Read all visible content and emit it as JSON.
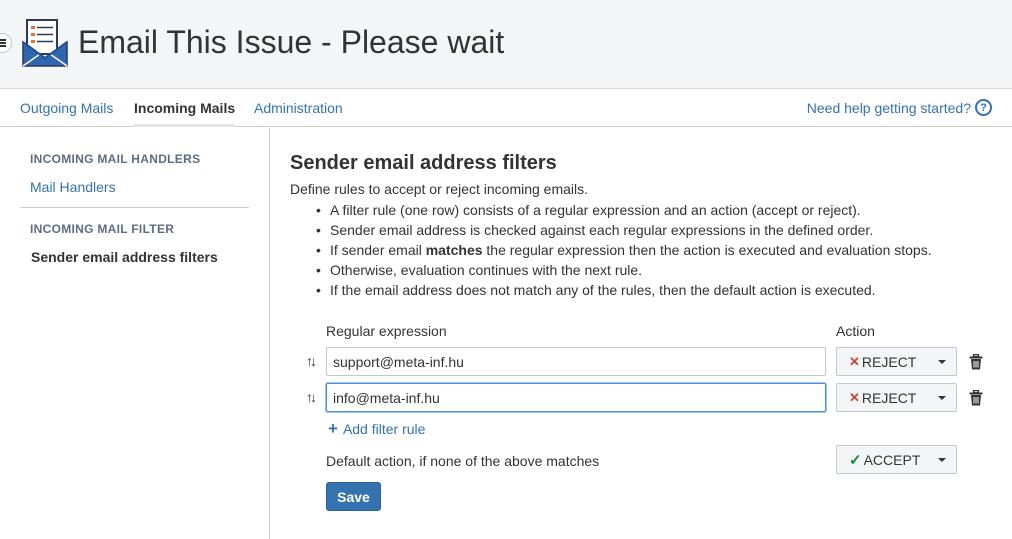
{
  "header": {
    "title": "Email This Issue - Please wait",
    "menu_icon": "hamburger-icon",
    "logo_icon": "email-checklist-logo-icon"
  },
  "nav": {
    "tabs": [
      {
        "label": "Outgoing Mails",
        "active": false
      },
      {
        "label": "Incoming Mails",
        "active": true
      },
      {
        "label": "Administration",
        "active": false
      }
    ],
    "help_label": "Need help getting started?",
    "help_icon": "question-circle-icon"
  },
  "sidebar": {
    "sections": [
      {
        "heading": "INCOMING MAIL HANDLERS",
        "items": [
          {
            "label": "Mail Handlers",
            "active": false
          }
        ]
      },
      {
        "heading": "INCOMING MAIL FILTER",
        "items": [
          {
            "label": "Sender email address filters",
            "active": true
          }
        ]
      }
    ]
  },
  "main": {
    "title": "Sender email address filters",
    "description": "Define rules to accept or reject incoming emails.",
    "bullets": [
      {
        "text": "A filter rule (one row) consists of a regular expression and an action (accept or reject)."
      },
      {
        "text": "Sender email address is checked against each regular expressions in the defined order."
      },
      {
        "before": "If sender email ",
        "bold": "matches",
        "after": " the regular expression then the action is executed and evaluation stops."
      },
      {
        "text": "Otherwise, evaluation continues with the next rule."
      },
      {
        "text": "If the email address does not match any of the rules, then the default action is executed."
      }
    ],
    "columns": {
      "regex": "Regular expression",
      "action": "Action"
    },
    "rules": [
      {
        "value": "support@meta-inf.hu",
        "action": "REJECT",
        "action_icon": "x-icon",
        "focused": false
      },
      {
        "value": "info@meta-inf.hu",
        "action": "REJECT",
        "action_icon": "x-icon",
        "focused": true
      }
    ],
    "add_rule_label": "Add filter rule",
    "default_label": "Default action, if none of the above matches",
    "default_action": {
      "label": "ACCEPT",
      "icon": "check-icon"
    },
    "save_label": "Save"
  },
  "colors": {
    "link": "#3572b0",
    "reject": "#d04437",
    "accept": "#14892c",
    "primary_button": "#3572b0",
    "header_bg": "#f4f5f7"
  }
}
